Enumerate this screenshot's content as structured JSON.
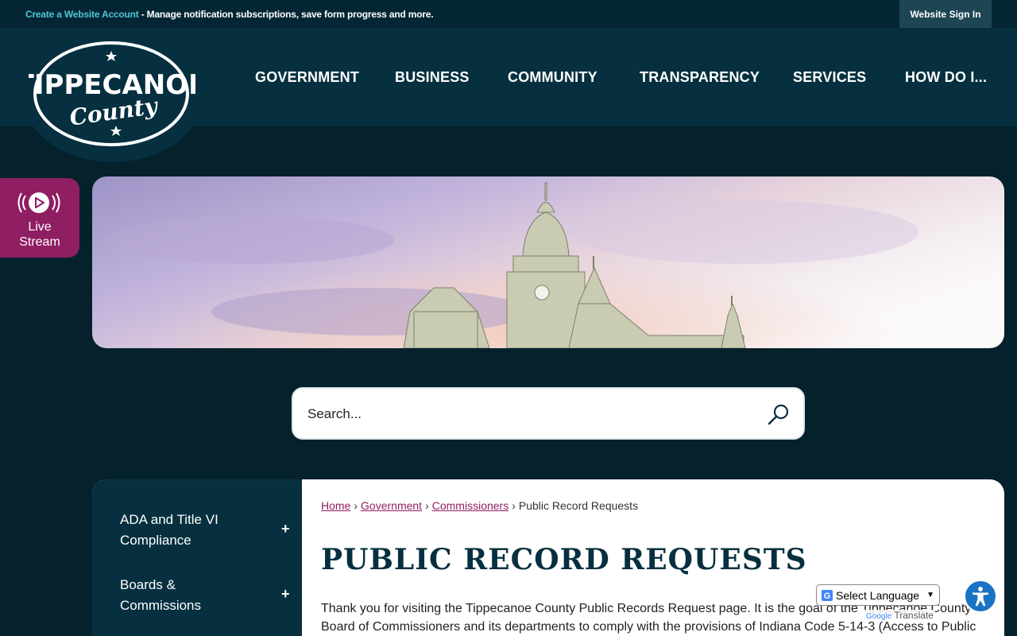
{
  "topbar": {
    "create_account_link": "Create a Website Account",
    "notice_text": " - Manage notification subscriptions, save form progress and more.",
    "signin_label": "Website Sign In"
  },
  "logo": {
    "line1": "TIPPECANOE",
    "line2": "County"
  },
  "nav": {
    "items": [
      "GOVERNMENT",
      "BUSINESS",
      "COMMUNITY",
      "TRANSPARENCY",
      "SERVICES",
      "HOW DO I..."
    ]
  },
  "live_stream": {
    "label_line1": "Live",
    "label_line2": "Stream"
  },
  "search": {
    "placeholder": "Search..."
  },
  "sidenav": {
    "items": [
      {
        "line1": "ADA and Title VI",
        "line2": "Compliance",
        "toggle": "+"
      },
      {
        "line1": "Boards &",
        "line2": "Commissions",
        "toggle": "+"
      }
    ]
  },
  "breadcrumb": {
    "home": "Home",
    "government": "Government",
    "commissioners": "Commissioners",
    "current": "Public Record Requests",
    "separator": "›"
  },
  "page": {
    "title": "PUBLIC RECORD REQUESTS",
    "intro": "Thank you for visiting the Tippecanoe County Public Records Request page.  It is the goal of the Tippecanoe County Board of Commissioners and its departments to comply with the provisions of Indiana Code 5-14-3 (Access to Public"
  },
  "translate": {
    "select_label": "Select Language",
    "powered_by": "Google",
    "translate_word": "Translate"
  },
  "colors": {
    "background": "#04212c",
    "header": "#06303f",
    "accent_link": "#4fc4d4",
    "live_stream": "#8f1e62",
    "breadcrumb_link": "#8f1e62",
    "accessibility": "#1a72c4"
  },
  "icons": {
    "live_stream": "play-broadcast-icon",
    "search": "search-icon",
    "accessibility": "accessibility-icon",
    "google": "google-g-icon"
  }
}
